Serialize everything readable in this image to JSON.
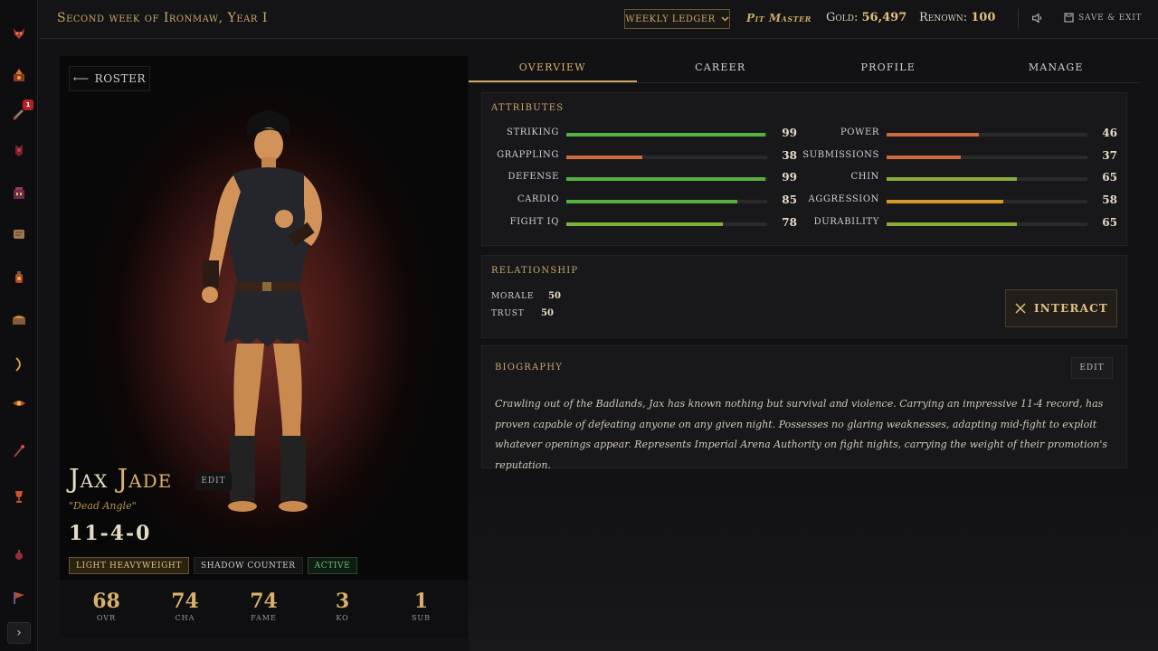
{
  "topbar": {
    "date": "Second week of Ironmaw, Year I",
    "ledger_label": "Weekly Ledger",
    "role": "Pit Master",
    "gold_label": "Gold:",
    "gold_value": "56,497",
    "renown_label": "Renown:",
    "renown_value": "100",
    "save_label": "Save & Exit"
  },
  "sidebar": {
    "icons": [
      "demon-mask-icon",
      "forge-icon",
      "alert-icon",
      "beast-icon",
      "building-icon",
      "scroll-icon",
      "lantern-icon",
      "chest-icon",
      "bow-icon",
      "eye-icon",
      "spear-icon",
      "trophy-icon",
      "potion-icon",
      "flag-icon"
    ],
    "badge": "1"
  },
  "fighter": {
    "back_label": "Roster",
    "first_name": "Jax",
    "last_name": "Jade",
    "edit_label": "Edit",
    "nickname": "\"Dead Angle\"",
    "record": "11-4-0",
    "tags": [
      "Light Heavyweight",
      "Shadow Counter",
      "Active"
    ],
    "stats": [
      {
        "value": "68",
        "label": "OVR"
      },
      {
        "value": "74",
        "label": "CHA"
      },
      {
        "value": "74",
        "label": "FAME"
      },
      {
        "value": "3",
        "label": "KO"
      },
      {
        "value": "1",
        "label": "SUB"
      }
    ]
  },
  "tabs": [
    "Overview",
    "Career",
    "Profile",
    "Manage"
  ],
  "attributes": {
    "title": "Attributes",
    "left": [
      {
        "label": "Striking",
        "value": 99,
        "color": "#55b040"
      },
      {
        "label": "Grappling",
        "value": 38,
        "color": "#cc6a3a"
      },
      {
        "label": "Defense",
        "value": 99,
        "color": "#55b040"
      },
      {
        "label": "Cardio",
        "value": 85,
        "color": "#55b040"
      },
      {
        "label": "Fight IQ",
        "value": 78,
        "color": "#7cb23a"
      }
    ],
    "right": [
      {
        "label": "Power",
        "value": 46,
        "color": "#cc6a3a"
      },
      {
        "label": "Submissions",
        "value": 37,
        "color": "#cc6a3a"
      },
      {
        "label": "Chin",
        "value": 65,
        "color": "#8aad36"
      },
      {
        "label": "Aggression",
        "value": 58,
        "color": "#d49a26"
      },
      {
        "label": "Durability",
        "value": 65,
        "color": "#8aad36"
      }
    ]
  },
  "relationship": {
    "title": "Relationship",
    "morale_label": "Morale",
    "morale_value": "50",
    "trust_label": "Trust",
    "trust_value": "50",
    "interact_label": "Interact"
  },
  "biography": {
    "title": "Biography",
    "edit_label": "Edit",
    "text": "Crawling out of the Badlands, Jax has known nothing but survival and violence. Carrying an impressive 11-4 record, has proven capable of defeating anyone on any given night. Possesses no glaring weaknesses, adapting mid-fight to exploit whatever openings appear. Represents Imperial Arena Authority on fight nights, carrying the weight of their promotion's reputation."
  }
}
